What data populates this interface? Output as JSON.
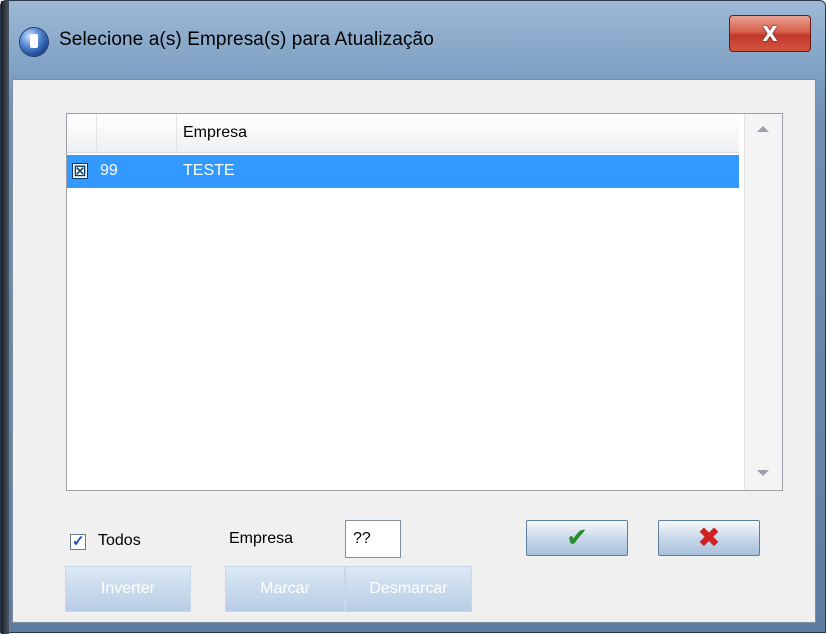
{
  "window": {
    "title": "Selecione a(s) Empresa(s) para Atualização",
    "close_label": "X"
  },
  "grid": {
    "columns": [
      "",
      "",
      "Empresa"
    ],
    "rows": [
      {
        "checked": true,
        "checkbox_glyph": "☒",
        "code": "99",
        "name": "TESTE",
        "selected": true
      }
    ]
  },
  "controls": {
    "todos_label": "Todos",
    "todos_checked": true,
    "todos_glyph": "✓",
    "empresa_label": "Empresa",
    "empresa_value": "??",
    "ok_icon": "✔",
    "cancel_icon": "✖",
    "inverter_label": "Inverter",
    "marcar_label": "Marcar",
    "desmarcar_label": "Desmarcar"
  },
  "icons": {
    "title_icon": "app-globe-icon",
    "ok_icon_name": "checkmark-icon",
    "cancel_icon_name": "x-icon"
  },
  "colors": {
    "selection": "#3399ff",
    "ok": "#2a8c2a",
    "cancel": "#d02020",
    "close": "#c0392b"
  }
}
